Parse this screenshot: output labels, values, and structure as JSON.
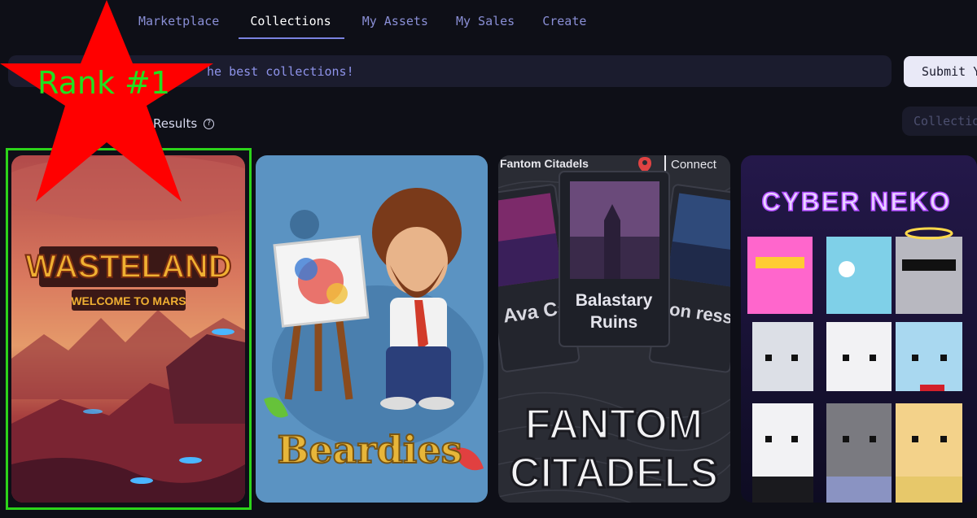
{
  "nav": {
    "tabs": [
      {
        "label": "Marketplace",
        "active": false
      },
      {
        "label": "Collections",
        "active": true
      },
      {
        "label": "My Assets",
        "active": false
      },
      {
        "label": "My Sales",
        "active": false
      },
      {
        "label": "Create",
        "active": false
      }
    ]
  },
  "banner": {
    "text": "he best collections!",
    "submit_label": "Submit Y"
  },
  "results": {
    "label": "Results",
    "help_glyph": "?"
  },
  "filter": {
    "label": "Collectio"
  },
  "annotation": {
    "rank_label": "Rank #1",
    "star_color": "#ff0000",
    "box_color": "#2cd41a"
  },
  "cards": [
    {
      "name": "Wasteland",
      "title": "WASTELAND",
      "subtitle": "WELCOME TO MARS"
    },
    {
      "name": "Beardies",
      "title": "Beardies"
    },
    {
      "name": "Fantom Citadels",
      "header_left": "Fantom Citadels",
      "header_right": "Connect",
      "center_card": "Balastary Ruins",
      "left_card": "Ava Ca",
      "right_card": "ellion ress",
      "title_line1": "FANTOM",
      "title_line2": "CITADELS"
    },
    {
      "name": "Cyber Neko",
      "title": "CYBER NEKO"
    }
  ],
  "colors": {
    "background": "#0e0f17",
    "accent": "#7b82e0",
    "nav_text": "#8a8fd6"
  }
}
